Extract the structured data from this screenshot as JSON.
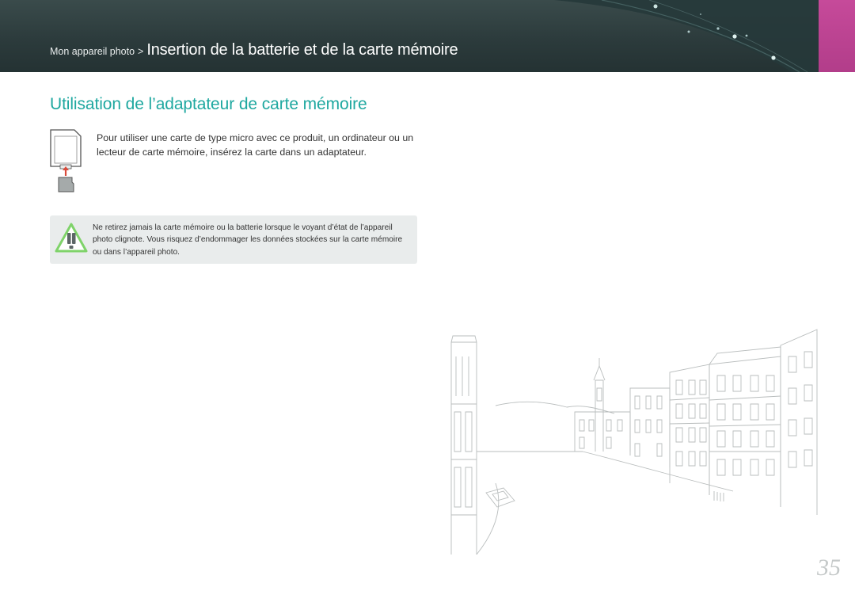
{
  "header": {
    "breadcrumb_parent": "Mon appareil photo",
    "breadcrumb_separator": ">",
    "breadcrumb_current": "Insertion de la batterie et de la carte mémoire",
    "accent_color": "#c64a9a",
    "background_color": "#2f3f40"
  },
  "section": {
    "title": "Utilisation de l’adaptateur de carte mémoire",
    "title_color": "#1fa8a0",
    "body": "Pour utiliser une carte de type micro avec ce produit, un ordinateur ou un lecteur de carte mémoire, insérez la carte dans un adaptateur.",
    "illustration_icon": "memory-card-adapter-icon"
  },
  "warning": {
    "icon": "warning-triangle-icon",
    "icon_color": "#7fd36a",
    "text": "Ne retirez jamais la carte mémoire ou la batterie lorsque le voyant d’état de l’appareil photo clignote. Vous risquez d’endommager les données stockées sur la carte mémoire ou dans l’appareil photo."
  },
  "decoration": {
    "sketch": "city-canal-sketch"
  },
  "page_number": "35"
}
